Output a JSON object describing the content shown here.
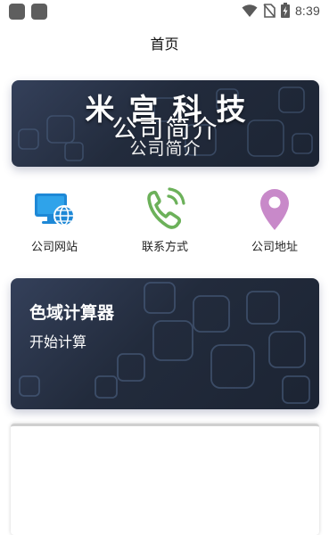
{
  "status_bar": {
    "time": "8:39"
  },
  "header": {
    "title": "首页"
  },
  "banner": {
    "brand": "米宫科技",
    "heading": "公司简介",
    "subheading": "公司简介"
  },
  "quick_links": [
    {
      "label": "公司网站",
      "icon": "computer-globe-icon",
      "color": "#1e88d6"
    },
    {
      "label": "联系方式",
      "icon": "phone-icon",
      "color": "#6cb15a"
    },
    {
      "label": "公司地址",
      "icon": "location-pin-icon",
      "color": "#c889c9"
    }
  ],
  "calculator_card": {
    "title": "色域计算器",
    "action": "开始计算"
  }
}
